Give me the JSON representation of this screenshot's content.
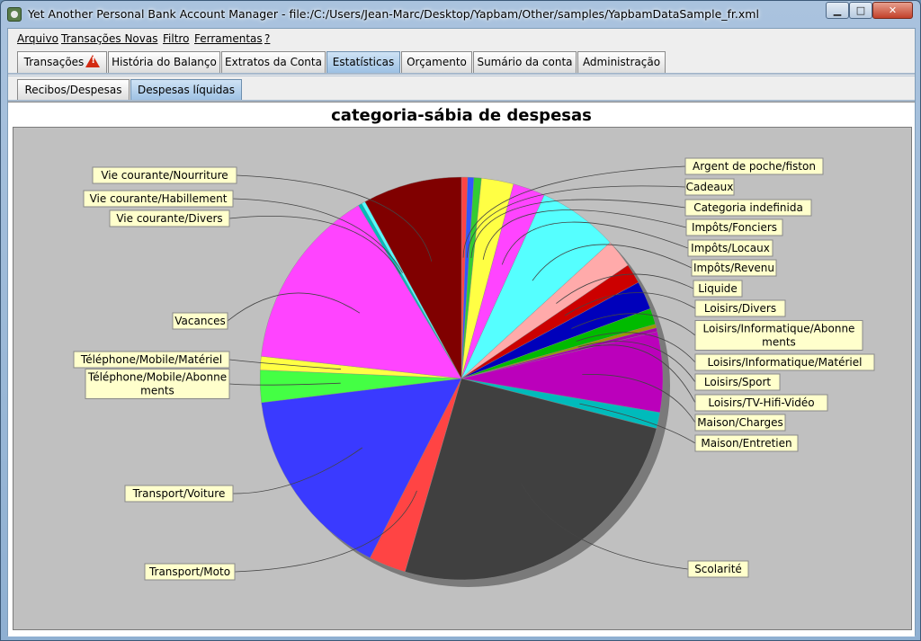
{
  "window": {
    "title": "Yet Another Personal Bank Account Manager - file:/C:/Users/Jean-Marc/Desktop/Yapbam/Other/samples/YapbamDataSample_fr.xml",
    "minimize": "▁",
    "maximize": "□",
    "close": "✕"
  },
  "menu": [
    {
      "label": "Arquivo"
    },
    {
      "label": "Transações Novas"
    },
    {
      "label": "Filtro"
    },
    {
      "label": "Ferramentas"
    },
    {
      "label": "?"
    }
  ],
  "tabs": [
    {
      "label": "Transações",
      "warning": true
    },
    {
      "label": "História do Balanço"
    },
    {
      "label": "Extratos da Conta"
    },
    {
      "label": "Estatísticas",
      "active": true
    },
    {
      "label": "Orçamento"
    },
    {
      "label": "Sumário da conta"
    },
    {
      "label": "Administração"
    }
  ],
  "subtabs": [
    {
      "label": "Recibos/Despesas"
    },
    {
      "label": "Despesas líquidas",
      "active": true
    }
  ],
  "chart_data": {
    "type": "pie",
    "title": "categoria-sábia de despesas",
    "start_angle_deg": 0,
    "direction": "clockwise",
    "slices": [
      {
        "label": "Argent de poche/fiston",
        "value": 0.5,
        "color": "#ff4444",
        "side": "right"
      },
      {
        "label": "Cadeaux",
        "value": 0.5,
        "color": "#3355ff",
        "side": "right"
      },
      {
        "label": "Categoria indefinida",
        "value": 0.6,
        "color": "#33cc33",
        "side": "right"
      },
      {
        "label": "Impôts/Fonciers",
        "value": 2.6,
        "color": "#ffff44",
        "side": "right"
      },
      {
        "label": "Impôts/Locaux",
        "value": 2.6,
        "color": "#ff44ff",
        "side": "right"
      },
      {
        "label": "Impôts/Revenu",
        "value": 6.5,
        "color": "#55ffff",
        "side": "right"
      },
      {
        "label": "Liquide",
        "value": 2.3,
        "color": "#ffaaaa",
        "side": "right"
      },
      {
        "label": "Loisirs/Divers",
        "value": 1.6,
        "color": "#cc0000",
        "side": "right"
      },
      {
        "label": "Loisirs/Informatique/Abonnements",
        "value": 2.3,
        "color": "#0000bb",
        "side": "right"
      },
      {
        "label": "Loisirs/Informatique/Matériel",
        "value": 1.3,
        "color": "#00bb00",
        "side": "right"
      },
      {
        "label": "Loisirs/Sport",
        "value": 0.3,
        "color": "#999900",
        "side": "right"
      },
      {
        "label": "Loisirs/TV-Hifi-Vidéo",
        "value": 0.3,
        "color": "#aa00aa",
        "side": "right"
      },
      {
        "label": "Maison/Charges",
        "value": 6.5,
        "color": "#bb00bb",
        "side": "right"
      },
      {
        "label": "Maison/Entretien",
        "value": 1.3,
        "color": "#00bbbb",
        "side": "right"
      },
      {
        "label": "Scolarité",
        "value": 25.7,
        "color": "#404040",
        "side": "right"
      },
      {
        "label": "Transport/Moto",
        "value": 3.0,
        "color": "#ff4444",
        "side": "left"
      },
      {
        "label": "Transport/Voiture",
        "value": 15.7,
        "color": "#3a3aff",
        "side": "left"
      },
      {
        "label": "Téléphone/Mobile/Abonnements",
        "value": 2.6,
        "color": "#44ff44",
        "side": "left"
      },
      {
        "label": "Téléphone/Mobile/Matériel",
        "value": 1.1,
        "color": "#ffff44",
        "side": "left"
      },
      {
        "label": "Vacances",
        "value": 14.8,
        "color": "#ff44ff",
        "side": "left"
      },
      {
        "label": "Vie courante/Divers",
        "value": 0.3,
        "color": "#00bbbb",
        "side": "left"
      },
      {
        "label": "Vie courante/Habillement",
        "value": 0.3,
        "color": "#55ffff",
        "side": "left"
      },
      {
        "label": "Vie courante/Nourriture",
        "value": 8.0,
        "color": "#800000",
        "side": "left"
      }
    ]
  }
}
